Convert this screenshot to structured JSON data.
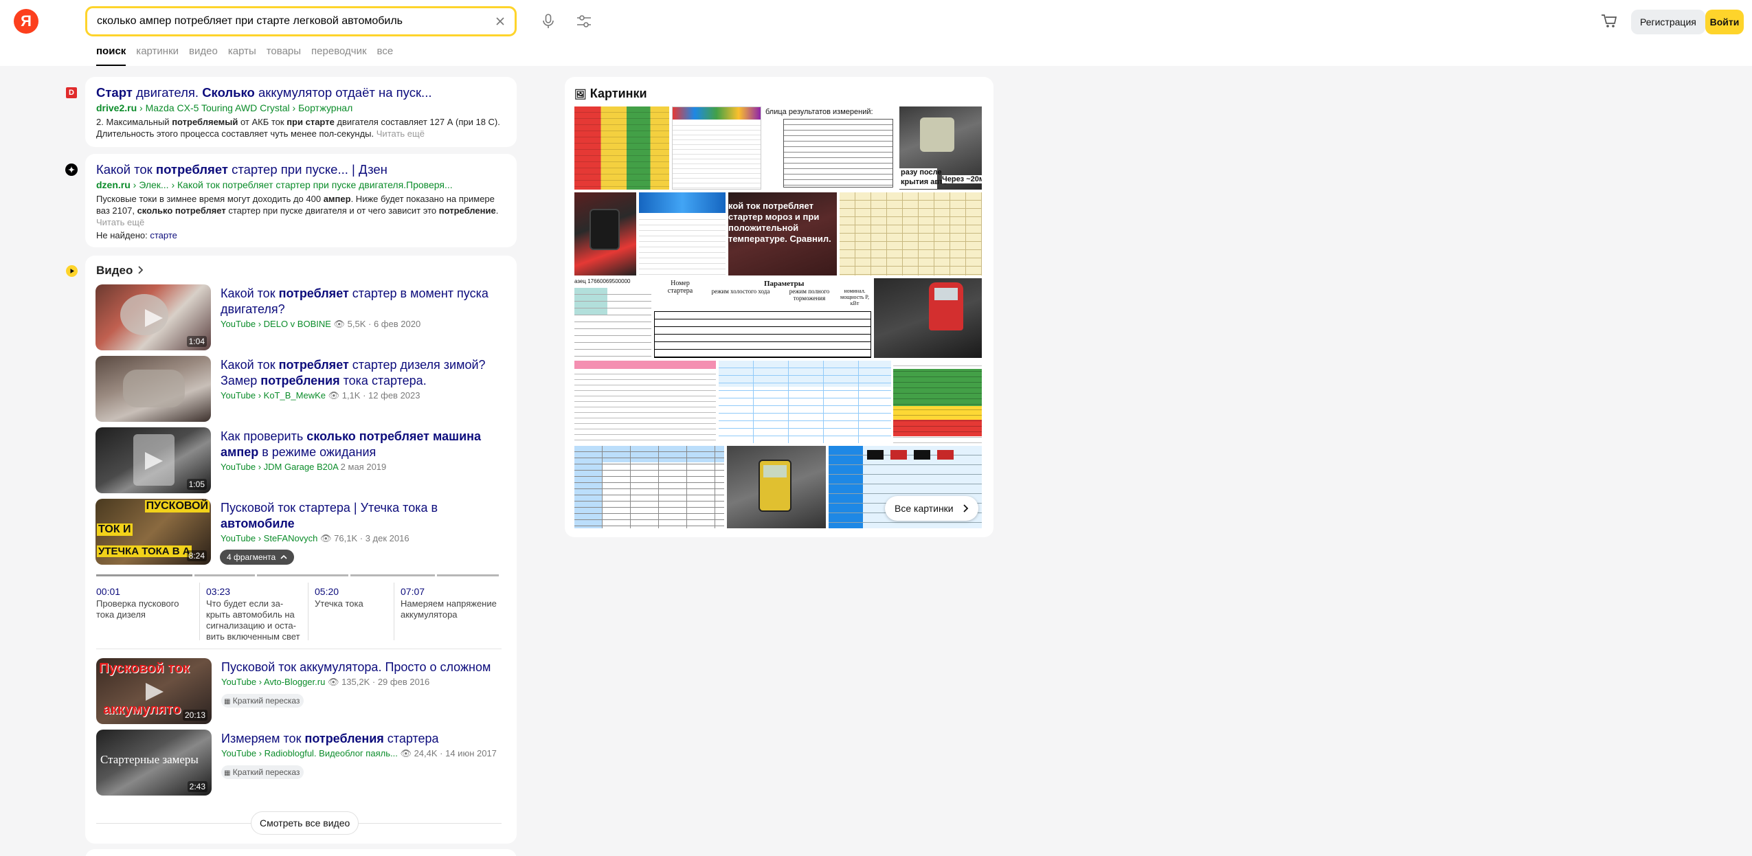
{
  "header": {
    "logo": "Я",
    "search_query": "сколько ампер потребляет при старте легковой автомобиль",
    "register": "Регистрация",
    "login": "Войти"
  },
  "tabs": [
    "поиск",
    "картинки",
    "видео",
    "карты",
    "товары",
    "переводчик",
    "все"
  ],
  "results": [
    {
      "favicon": "D",
      "title_html": "<b>Старт</b> двигателя. <b>Сколько</b> аккумулятор отдаёт на пуск...",
      "path_html": "<b>drive2.ru</b> › Mazda CX-5 Touring AWD Crystal › Бортжурнал",
      "snippet_html": "2. Максимальный <b>потребляемый</b> от АКБ ток <b>при старте</b> двигателя составляет 127 А (при 18 С). Длительность этого процесса составляет чуть менее пол-секунды. <span class=\"more\">Читать ещё</span>"
    },
    {
      "favicon": "dzen",
      "title_html": "Какой ток <b>потребляет</b> стартер при пуске... | Дзен",
      "path_html": "<b>dzen.ru</b> › Элек... › Какой ток потребляет стартер при пуске двигателя.Проверя...",
      "snippet_html": "Пусковые токи в зимнее время могут доходить до 400 <b>ампер</b>. Ниже будет показано на примере ваз 2107, <b>сколько потребляет</b> стартер при пуске двигателя и от чего зависит это <b>потребление</b>. <span class=\"more\">Читать ещё</span>",
      "not_found_label": "Не найдено:",
      "not_found_word": "старте"
    }
  ],
  "video": {
    "section_title": "Видео",
    "items": [
      {
        "title_html": "Какой ток <b>потребляет</b> стартер в момент пуска двигателя?",
        "source": "YouTube",
        "channel": "DELO v BOBINE",
        "views": "5,5K",
        "date": "6 фев 2020",
        "duration": "1:04"
      },
      {
        "title_html": "Какой ток <b>потребляет</b> стартер дизеля зимой? Замер <b>потребления</b> тока стартера.",
        "source": "YouTube",
        "channel": "KoT_B_MewKe",
        "views": "1,1K",
        "date": "12 фев 2023",
        "duration": ""
      },
      {
        "title_html": "Как проверить <b>сколько потребляет машина ампер</b> в режиме ожидания",
        "source": "YouTube",
        "channel": "JDM Garage B20A",
        "views": "",
        "date": "2 мая 2019",
        "duration": "1:05"
      },
      {
        "title_html": "Пусковой ток стартера | Утечка тока в <b>автомобиле</b>",
        "source": "YouTube",
        "channel": "SteFANovych",
        "views": "76,1K",
        "date": "3 дек 2016",
        "duration": "8:24",
        "thumb_text_1": "ПУСКОВОЙ",
        "thumb_text_2": "ТОК И",
        "thumb_text_3": "УТЕЧКА ТОКА В А"
      },
      {
        "title_html": "Пусковой ток аккумулятора. Просто о сложном",
        "source": "YouTube",
        "channel": "Avto-Blogger.ru",
        "views": "135,2K",
        "date": "29 фев 2016",
        "duration": "20:13",
        "thumb_text_1": "Пусковой ток",
        "thumb_text_2": "аккумулято"
      },
      {
        "title_html": "Измеряем ток <b>потребления</b> стартера",
        "source": "YouTube",
        "channel": "Radioblogful. Видеоблог паяль...",
        "views": "24,4K",
        "date": "14 июн 2017",
        "duration": "2:43",
        "thumb_text_1": "Стартерные замеры"
      }
    ],
    "fragments_label": "4 фрагмента",
    "chapters": [
      {
        "time": "00:01",
        "text": "Проверка пускового тока дизеля"
      },
      {
        "time": "03:23",
        "text": "Что будет если за-крыть автомобиль на сигнализацию и оста-вить включенным свет"
      },
      {
        "time": "05:20",
        "text": "Утечка тока"
      },
      {
        "time": "07:07",
        "text": "Намеряем напряжение аккумулятора"
      }
    ],
    "summary_label": "Краткий пересказ",
    "all_videos": "Смотреть все видео"
  },
  "images": {
    "section_title": "Картинки",
    "all_images": "Все картинки",
    "tile_texts": {
      "t3": "блица результатов измерений:",
      "t4a": "разу после",
      "t4b": "крытия авто",
      "t4c": "Через ~20м",
      "t7": "кой ток потребляет стартер мороз и при положительной температуре. Сравнил.",
      "t10a": "Номер стартера",
      "t10b": "Параметры",
      "t10c": "режим холостого хода",
      "t10d": "режим полного торможения",
      "t10e": "номинал. мощность P, кВт",
      "t9": "азец 17660069500000"
    }
  }
}
